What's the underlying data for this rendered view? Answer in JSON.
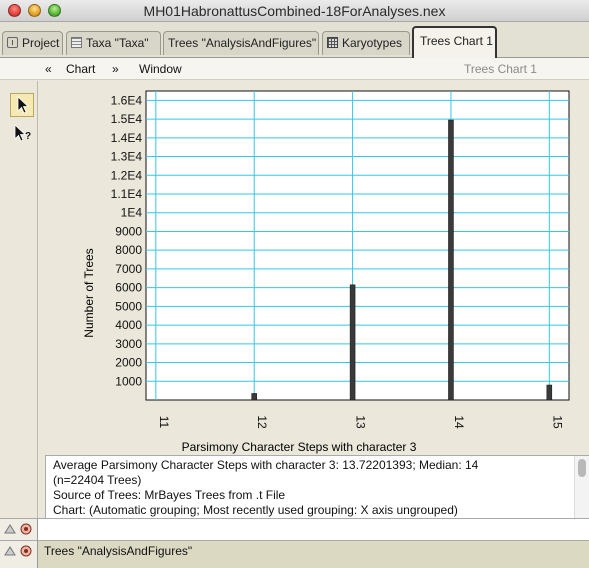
{
  "window": {
    "title": "MH01HabronattusCombined-18ForAnalyses.nex"
  },
  "tabs": [
    {
      "label": "Project",
      "icon": "project-icon"
    },
    {
      "label": "Taxa \"Taxa\"",
      "icon": "taxa-icon"
    },
    {
      "label": "Trees \"AnalysisAndFigures\"",
      "icon": ""
    },
    {
      "label": "Karyotypes",
      "icon": "matrix-icon"
    },
    {
      "label": "Trees Chart 1",
      "icon": "",
      "active": true
    }
  ],
  "menu": {
    "back": "«",
    "chart": "Chart",
    "forward": "»",
    "window": "Window",
    "window_name": "Trees Chart 1"
  },
  "tools": [
    {
      "name": "arrow-tool",
      "selected": true
    },
    {
      "name": "query-arrow-tool",
      "selected": false
    }
  ],
  "chart_data": {
    "type": "bar",
    "xlabel": "Parsimony Character Steps with character 3",
    "ylabel": "Number of Trees",
    "x_ticks": [
      "11",
      "12",
      "13",
      "14",
      "15"
    ],
    "y_ticks": [
      "1000",
      "2000",
      "3000",
      "4000",
      "5000",
      "6000",
      "7000",
      "8000",
      "9000",
      "1E4",
      "1.1E4",
      "1.2E4",
      "1.3E4",
      "1.4E4",
      "1.5E4",
      "1.6E4"
    ],
    "ylim": [
      0,
      16500
    ],
    "xlim": [
      10.9,
      15.2
    ],
    "points": [
      {
        "x": 12,
        "y": 350
      },
      {
        "x": 13,
        "y": 6150
      },
      {
        "x": 14,
        "y": 14950
      },
      {
        "x": 15,
        "y": 800
      }
    ],
    "grid": true,
    "grid_color": "#35c8e6",
    "bar_color": "#3a3a3a"
  },
  "info": {
    "line1": "Average Parsimony Character Steps with character 3: 13.72201393; Median: 14",
    "line2": "(n=22404  Trees)",
    "line3": "Source of  Trees: MrBayes Trees from .t File",
    "line4": "Chart:  (Automatic grouping; Most recently used grouping:  X axis ungrouped)"
  },
  "bottom": {
    "trees_label": "Trees \"AnalysisAndFigures\""
  }
}
